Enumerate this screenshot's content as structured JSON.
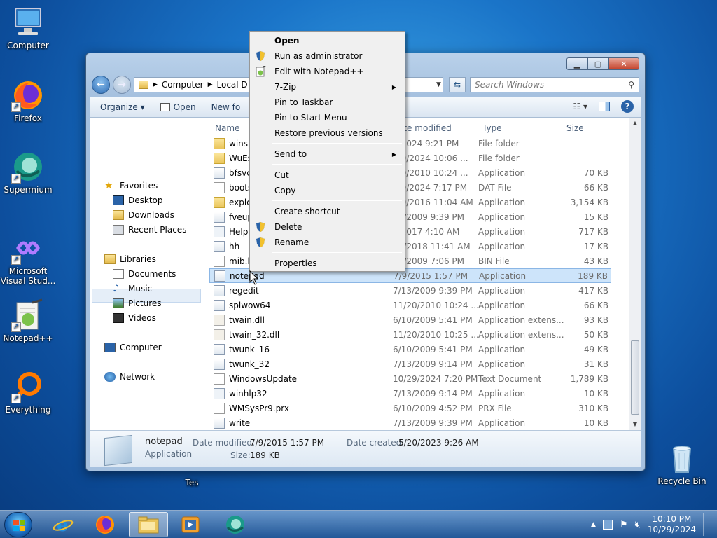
{
  "desktop": {
    "icons": [
      {
        "label": "Computer",
        "name": "computer"
      },
      {
        "label": "Firefox",
        "name": "firefox"
      },
      {
        "label": "Supermium",
        "name": "supermium"
      },
      {
        "label": "Microsoft Visual Stud...",
        "name": "visual-studio"
      },
      {
        "label": "Notepad++",
        "name": "notepadpp"
      },
      {
        "label": "Everything",
        "name": "everything"
      },
      {
        "label": "Recycle Bin",
        "name": "recycle-bin"
      }
    ],
    "partial_label": "Tes"
  },
  "explorer": {
    "address": {
      "crumbs": [
        "Computer",
        "Local D"
      ]
    },
    "search_placeholder": "Search Windows",
    "toolbar": {
      "organize": "Organize",
      "open": "Open",
      "new_folder": "New fo"
    },
    "nav": {
      "favorites": "Favorites",
      "desktop": "Desktop",
      "downloads": "Downloads",
      "recent": "Recent Places",
      "libraries": "Libraries",
      "documents": "Documents",
      "music": "Music",
      "pictures": "Pictures",
      "videos": "Videos",
      "computer": "Computer",
      "network": "Network"
    },
    "columns": {
      "name": "Name",
      "date": "ate modified",
      "type": "Type",
      "size": "Size"
    },
    "files": [
      {
        "name": "winsx",
        "date": "7/2024 9:21 PM",
        "type": "File folder",
        "size": "",
        "icon": "folder"
      },
      {
        "name": "WuEs",
        "date": "/29/2024 10:06 ...",
        "type": "File folder",
        "size": "",
        "icon": "folder"
      },
      {
        "name": "bfsvc",
        "date": "/20/2010 10:24 ...",
        "type": "Application",
        "size": "70 KB",
        "icon": "exe"
      },
      {
        "name": "boots",
        "date": "/29/2024 7:17 PM",
        "type": "DAT File",
        "size": "66 KB",
        "icon": "txt"
      },
      {
        "name": "explo",
        "date": "/29/2016 11:04 AM",
        "type": "Application",
        "size": "3,154 KB",
        "icon": "folder"
      },
      {
        "name": "fveup",
        "date": "13/2009 9:39 PM",
        "type": "Application",
        "size": "15 KB",
        "icon": "exe"
      },
      {
        "name": "HelpP",
        "date": "2/2017 4:10 AM",
        "type": "Application",
        "size": "717 KB",
        "icon": "help"
      },
      {
        "name": "hh",
        "date": "18/2018 11:41 AM",
        "type": "Application",
        "size": "17 KB",
        "icon": "exe"
      },
      {
        "name": "mib.b",
        "date": "13/2009 7:06 PM",
        "type": "BIN File",
        "size": "43 KB",
        "icon": "txt"
      },
      {
        "name": "notepad",
        "date": "7/9/2015 1:57 PM",
        "type": "Application",
        "size": "189 KB",
        "icon": "exe"
      },
      {
        "name": "regedit",
        "date": "7/13/2009 9:39 PM",
        "type": "Application",
        "size": "417 KB",
        "icon": "exe"
      },
      {
        "name": "splwow64",
        "date": "11/20/2010 10:24 ...",
        "type": "Application",
        "size": "66 KB",
        "icon": "exe"
      },
      {
        "name": "twain.dll",
        "date": "6/10/2009 5:41 PM",
        "type": "Application extens...",
        "size": "93 KB",
        "icon": "dll"
      },
      {
        "name": "twain_32.dll",
        "date": "11/20/2010 10:25 ...",
        "type": "Application extens...",
        "size": "50 KB",
        "icon": "dll"
      },
      {
        "name": "twunk_16",
        "date": "6/10/2009 5:41 PM",
        "type": "Application",
        "size": "49 KB",
        "icon": "exe"
      },
      {
        "name": "twunk_32",
        "date": "7/13/2009 9:14 PM",
        "type": "Application",
        "size": "31 KB",
        "icon": "exe"
      },
      {
        "name": "WindowsUpdate",
        "date": "10/29/2024 7:20 PM",
        "type": "Text Document",
        "size": "1,789 KB",
        "icon": "txt"
      },
      {
        "name": "winhlp32",
        "date": "7/13/2009 9:14 PM",
        "type": "Application",
        "size": "10 KB",
        "icon": "help"
      },
      {
        "name": "WMSysPr9.prx",
        "date": "6/10/2009 4:52 PM",
        "type": "PRX File",
        "size": "310 KB",
        "icon": "txt"
      },
      {
        "name": "write",
        "date": "7/13/2009 9:39 PM",
        "type": "Application",
        "size": "10 KB",
        "icon": "exe"
      }
    ],
    "details": {
      "name": "notepad",
      "kind": "Application",
      "date_modified_label": "Date modified:",
      "date_modified": "7/9/2015 1:57 PM",
      "date_created_label": "Date created:",
      "date_created": "5/20/2023 9:26 AM",
      "size_label": "Size:",
      "size": "189 KB"
    }
  },
  "context_menu": {
    "items": [
      {
        "label": "Open"
      },
      {
        "label": "Run as administrator"
      },
      {
        "label": "Edit with Notepad++"
      },
      {
        "label": "7-Zip"
      },
      {
        "label": "Pin to Taskbar"
      },
      {
        "label": "Pin to Start Menu"
      },
      {
        "label": "Restore previous versions"
      },
      {
        "label": "Send to"
      },
      {
        "label": "Cut"
      },
      {
        "label": "Copy"
      },
      {
        "label": "Create shortcut"
      },
      {
        "label": "Delete"
      },
      {
        "label": "Rename"
      },
      {
        "label": "Properties"
      }
    ]
  },
  "taskbar": {
    "time": "10:10 PM",
    "date": "10/29/2024"
  }
}
